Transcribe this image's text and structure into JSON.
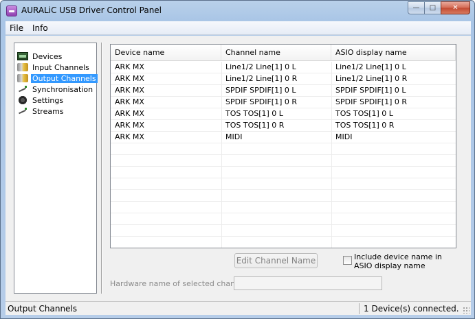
{
  "window": {
    "title": "AURALiC USB Driver Control Panel",
    "controls": {
      "minimize": "—",
      "maximize": "□",
      "close": "✕"
    }
  },
  "menubar": {
    "items": [
      "File",
      "Info"
    ]
  },
  "sidebar": {
    "items": [
      {
        "label": "Devices",
        "icon": "devices-icon"
      },
      {
        "label": "Input Channels",
        "icon": "input-channels-icon"
      },
      {
        "label": "Output Channels",
        "icon": "output-channels-icon",
        "selected": true
      },
      {
        "label": "Synchronisation",
        "icon": "synchronisation-icon"
      },
      {
        "label": "Settings",
        "icon": "settings-icon"
      },
      {
        "label": "Streams",
        "icon": "streams-icon"
      }
    ]
  },
  "table": {
    "headers": [
      "Device name",
      "Channel name",
      "ASIO display name"
    ],
    "rows": [
      [
        "ARK MX",
        "Line1/2 Line[1] 0 L",
        "Line1/2 Line[1] 0 L"
      ],
      [
        "ARK MX",
        "Line1/2 Line[1] 0 R",
        "Line1/2 Line[1] 0 R"
      ],
      [
        "ARK MX",
        "SPDIF SPDIF[1] 0 L",
        "SPDIF SPDIF[1] 0 L"
      ],
      [
        "ARK MX",
        "SPDIF SPDIF[1] 0 R",
        "SPDIF SPDIF[1] 0 R"
      ],
      [
        "ARK MX",
        "TOS TOS[1] 0 L",
        "TOS TOS[1] 0 L"
      ],
      [
        "ARK MX",
        "TOS TOS[1] 0 R",
        "TOS TOS[1] 0 R"
      ],
      [
        "ARK MX",
        "MIDI",
        "MIDI"
      ],
      [
        "",
        "",
        ""
      ],
      [
        "",
        "",
        ""
      ],
      [
        "",
        "",
        ""
      ],
      [
        "",
        "",
        ""
      ],
      [
        "",
        "",
        ""
      ],
      [
        "",
        "",
        ""
      ],
      [
        "",
        "",
        ""
      ],
      [
        "",
        "",
        ""
      ],
      [
        "",
        "",
        ""
      ]
    ]
  },
  "controls": {
    "edit_button": "Edit Channel Name",
    "include_checkbox_label": "Include device name in ASIO display name",
    "include_checked": false,
    "hardware_label": "Hardware name of selected channel:",
    "hardware_value": ""
  },
  "statusbar": {
    "left": "Output Channels",
    "right": "1 Device(s) connected."
  },
  "colors": {
    "selection": "#3399ff",
    "title_gradient": "#b9d1ea",
    "close_button": "#c24a32"
  }
}
